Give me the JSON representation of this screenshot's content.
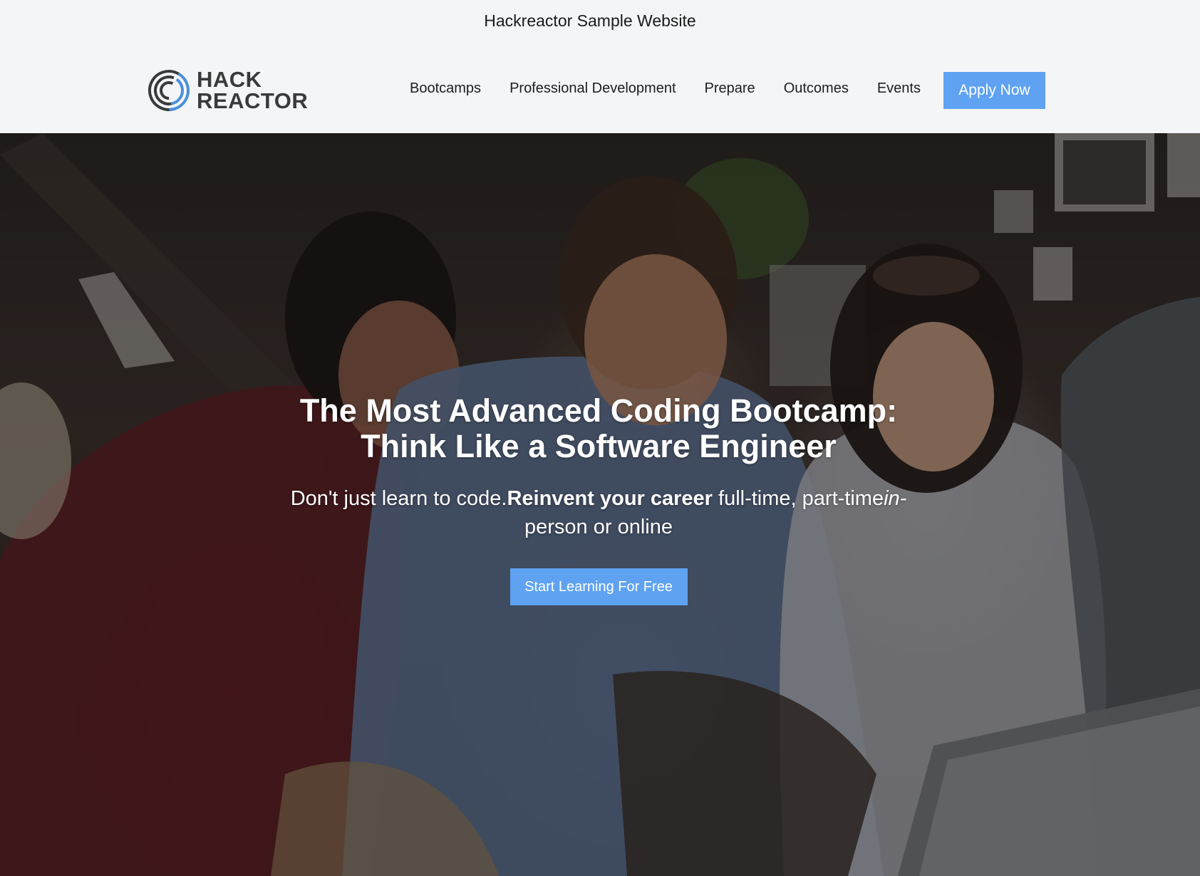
{
  "banner": {
    "text": "Hackreactor Sample Website"
  },
  "header": {
    "logo": {
      "line1": "HACK",
      "line2": "REACTOR",
      "icon": "hack-reactor-ring-logo"
    },
    "nav": [
      {
        "label": "Bootcamps"
      },
      {
        "label": "Professional Development"
      },
      {
        "label": "Prepare"
      },
      {
        "label": "Outcomes"
      },
      {
        "label": "Events"
      }
    ],
    "apply_label": "Apply Now"
  },
  "hero": {
    "title": "The Most Advanced Coding Bootcamp: Think Like a Software Engineer",
    "subtitle": {
      "part1": "Don't just learn to code.",
      "bold": "Reinvent your career",
      "part2": " full-time, part-time",
      "italic": "in-",
      "part3": "person or online"
    },
    "cta_label": "Start Learning For Free",
    "image": "students-collaborating-on-laptop-photo"
  },
  "colors": {
    "accent": "#5ea2f1",
    "logo_blue": "#4a90d9",
    "logo_gray": "#3a3a3a",
    "background": "#f4f5f7"
  }
}
